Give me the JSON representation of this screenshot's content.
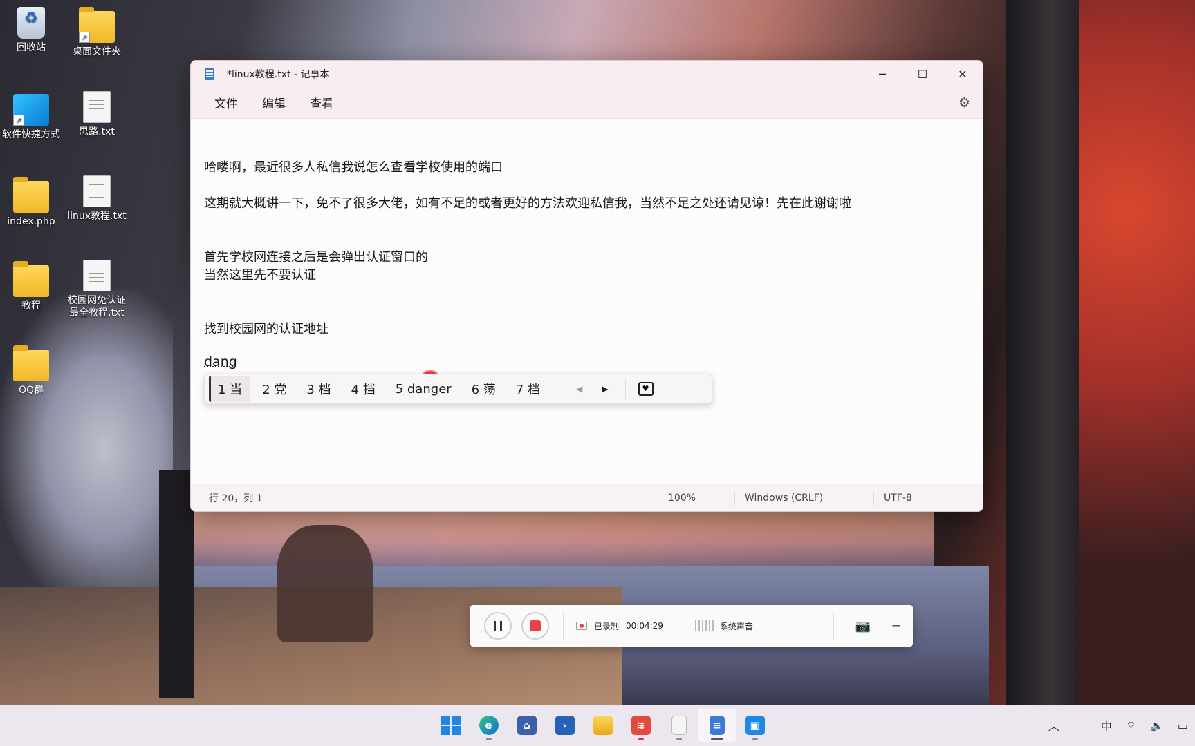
{
  "desktop": {
    "icons": [
      {
        "label": "回收站",
        "icon": "recycle-bin-icon"
      },
      {
        "label": "桌面文件夹",
        "icon": "folder-icon"
      },
      {
        "label": "软件快捷方式",
        "icon": "app-shortcut-icon"
      },
      {
        "label": "思路.txt",
        "icon": "text-file-icon"
      },
      {
        "label": "index.php",
        "icon": "folder-icon"
      },
      {
        "label": "linux教程.txt",
        "icon": "text-file-icon"
      },
      {
        "label": "教程",
        "icon": "folder-icon"
      },
      {
        "label": "校园网免认证最全教程.txt",
        "icon": "text-file-icon"
      },
      {
        "label": "QQ群",
        "icon": "folder-icon"
      }
    ]
  },
  "notepad": {
    "title": "*linux教程.txt - 记事本",
    "menu": [
      "文件",
      "编辑",
      "查看"
    ],
    "lines": [
      "哈喽啊，最近很多人私信我说怎么查看学校使用的端口",
      "这期就大概讲一下，免不了很多大佬，如有不足的或者更好的方法欢迎私信我，当然不足之处还请见谅！先在此谢谢啦",
      "首先学校网连接之后是会弹出认证窗口的",
      "当然这里先不要认证",
      "找到校园网的认证地址"
    ],
    "composition": "dang",
    "status": {
      "position": "行 20，列 1",
      "zoom": "100%",
      "line_ending": "Windows (CRLF)",
      "encoding": "UTF-8"
    }
  },
  "ime": {
    "candidates": [
      "1 当",
      "2 党",
      "3 档",
      "4 挡",
      "5 danger",
      "6 荡",
      "7 档"
    ],
    "selected_index": 0
  },
  "recorder": {
    "status_label": "已录制",
    "elapsed": "00:04:29",
    "audio_label": "系统声音"
  },
  "taskbar": {
    "apps": [
      "windows-start",
      "edge",
      "network-tool",
      "powershell",
      "file-explorer",
      "wifi-app",
      "blank-document",
      "notepad",
      "screen-recorder"
    ],
    "tray": {
      "ime_mode": "中"
    }
  },
  "colors": {
    "accent": "#1f86e6",
    "record_red": "#e8424a"
  }
}
